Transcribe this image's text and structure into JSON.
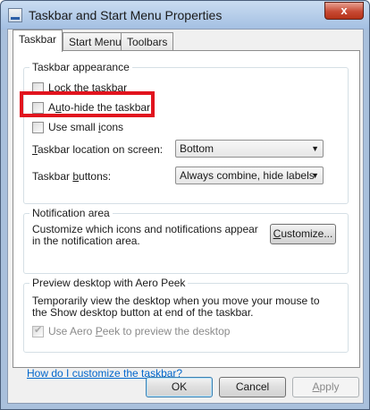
{
  "window": {
    "title": "Taskbar and Start Menu Properties",
    "close_glyph": "x"
  },
  "tabs": [
    {
      "label": "Taskbar",
      "active": true
    },
    {
      "label": "Start Menu",
      "active": false
    },
    {
      "label": "Toolbars",
      "active": false
    }
  ],
  "appearance": {
    "title": "Taskbar appearance",
    "lock": {
      "mnemonic": "L",
      "rest": "ock the taskbar",
      "checked": false
    },
    "autohide": {
      "prefix": "A",
      "mnemonic": "u",
      "rest": "to-hide the taskbar",
      "checked": false
    },
    "small_icons": {
      "prefix": "Use small ",
      "mnemonic": "i",
      "rest": "cons",
      "checked": false
    },
    "location_label": {
      "mnemonic": "T",
      "rest": "askbar location on screen:"
    },
    "location_value": "Bottom",
    "buttons_label": {
      "prefix": "Taskbar ",
      "mnemonic": "b",
      "rest": "uttons:"
    },
    "buttons_value": "Always combine, hide labels"
  },
  "notification": {
    "title": "Notification area",
    "text": "Customize which icons and notifications appear in the notification area.",
    "customize_button": {
      "mnemonic": "C",
      "rest": "ustomize..."
    }
  },
  "aero_peek": {
    "title": "Preview desktop with Aero Peek",
    "text": "Temporarily view the desktop when you move your mouse to the Show desktop button at end of the taskbar.",
    "checkbox": {
      "prefix": "Use Aero ",
      "mnemonic": "P",
      "rest": "eek to preview the desktop",
      "checked": true,
      "disabled": true
    }
  },
  "help_link": "How do I customize the taskbar?",
  "footer": {
    "ok": "OK",
    "cancel": "Cancel",
    "apply": {
      "mnemonic": "A",
      "rest": "pply"
    }
  },
  "colors": {
    "highlight": "#e1141e",
    "link": "#0066cc"
  }
}
